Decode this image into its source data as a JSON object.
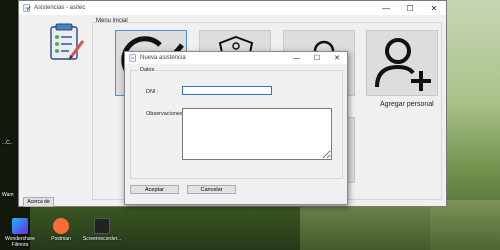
{
  "main_window": {
    "title": "Asistencias - asitec",
    "minimize_glyph": "—",
    "maximize_glyph": "☐",
    "close_glyph": "✕"
  },
  "menu": {
    "group_label": "Menu inicial",
    "tiles": [
      {
        "icon": "pencil-icon"
      },
      {
        "icon": "badge-icon"
      },
      {
        "icon": "user-icon"
      },
      {
        "icon": "add-user-icon",
        "label": "Agregar personal"
      }
    ]
  },
  "sidebar": {
    "logo_icon": "checklist-icon",
    "about_button": "Acerca de"
  },
  "dialog": {
    "title": "Nueva asistencia",
    "minimize_glyph": "—",
    "maximize_glyph": "☐",
    "close_glyph": "✕",
    "group_title": "Datos",
    "dni_label": "DNI :",
    "dni_value": "",
    "observaciones_label": "Observaciones :",
    "observaciones_value": "",
    "accept_button": "Aceptar",
    "cancel_button": "Cancelar"
  },
  "desktop": {
    "icons": [
      {
        "label": "Wondershare Filmora",
        "icon": "filmora-icon"
      },
      {
        "label": "Postman",
        "icon": "postman-icon"
      },
      {
        "label": "Screenrecorder...",
        "icon": "screenrecorder-icon"
      }
    ],
    "side_label_1": "Wam",
    "side_label_2": "...C.."
  },
  "colors": {
    "accent": "#2a74c8",
    "window_bg": "#f0f0f0",
    "tile_bg": "#dddddd"
  }
}
